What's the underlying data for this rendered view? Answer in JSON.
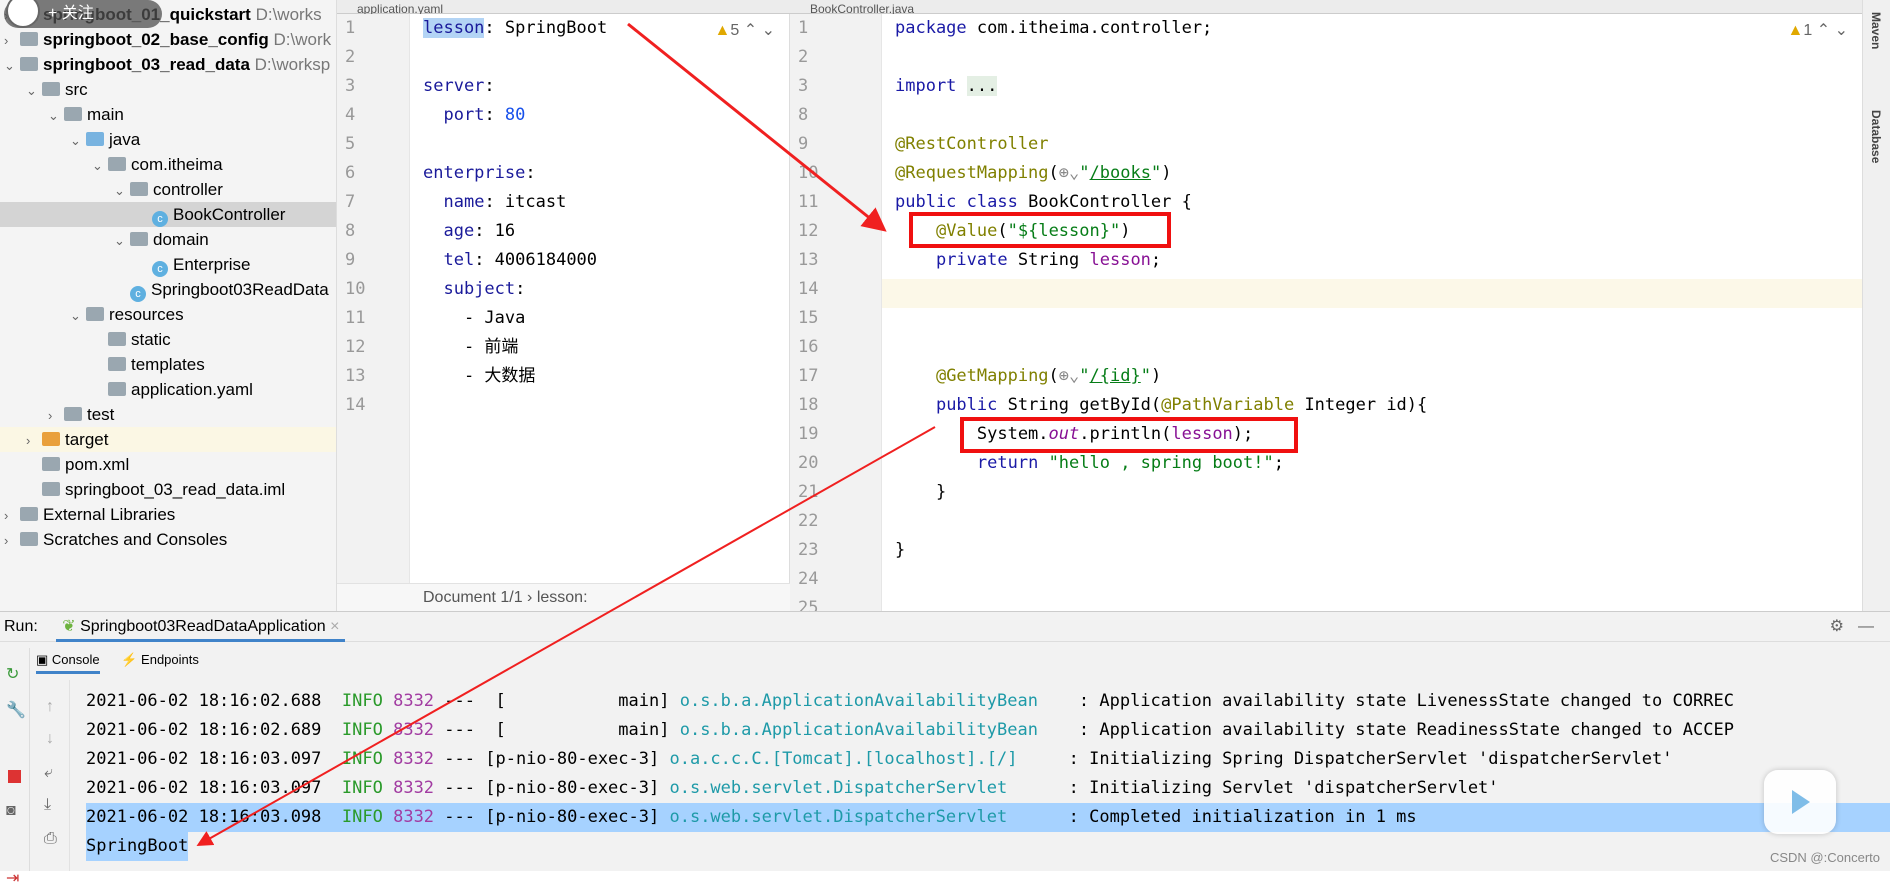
{
  "tree": [
    {
      "label": "springboot_01_quickstart",
      "path": "D:\\works",
      "level": 0,
      "arrow": "›",
      "icon": "module"
    },
    {
      "label": "springboot_02_base_config",
      "path": "D:\\work",
      "level": 0,
      "arrow": "›",
      "icon": "module"
    },
    {
      "label": "springboot_03_read_data",
      "path": "D:\\worksp",
      "level": 0,
      "arrow": "⌄",
      "icon": "module"
    },
    {
      "label": "src",
      "level": 1,
      "arrow": "⌄",
      "icon": "folder"
    },
    {
      "label": "main",
      "level": 2,
      "arrow": "⌄",
      "icon": "folder"
    },
    {
      "label": "java",
      "level": 3,
      "arrow": "⌄",
      "icon": "folder-blue"
    },
    {
      "label": "com.itheima",
      "level": 4,
      "arrow": "⌄",
      "icon": "package"
    },
    {
      "label": "controller",
      "level": 5,
      "arrow": "⌄",
      "icon": "package"
    },
    {
      "label": "BookController",
      "level": 6,
      "arrow": "",
      "icon": "class",
      "selected": true
    },
    {
      "label": "domain",
      "level": 5,
      "arrow": "⌄",
      "icon": "package"
    },
    {
      "label": "Enterprise",
      "level": 6,
      "arrow": "",
      "icon": "class"
    },
    {
      "label": "Springboot03ReadData",
      "level": 5,
      "arrow": "",
      "icon": "class"
    },
    {
      "label": "resources",
      "level": 3,
      "arrow": "⌄",
      "icon": "folder"
    },
    {
      "label": "static",
      "level": 4,
      "arrow": "",
      "icon": "folder"
    },
    {
      "label": "templates",
      "level": 4,
      "arrow": "",
      "icon": "folder"
    },
    {
      "label": "application.yaml",
      "level": 4,
      "arrow": "",
      "icon": "yaml"
    },
    {
      "label": "test",
      "level": 2,
      "arrow": "›",
      "icon": "folder"
    },
    {
      "label": "target",
      "level": 1,
      "arrow": "›",
      "icon": "folder-orange",
      "highlight": true
    },
    {
      "label": "pom.xml",
      "level": 1,
      "arrow": "",
      "icon": "maven"
    },
    {
      "label": "springboot_03_read_data.iml",
      "level": 1,
      "arrow": "",
      "icon": "file"
    },
    {
      "label": "External Libraries",
      "level": 0,
      "arrow": "›",
      "icon": "libs"
    },
    {
      "label": "Scratches and Consoles",
      "level": 0,
      "arrow": "›",
      "icon": "scratch"
    }
  ],
  "follow_badge": "+ 关注",
  "tabs": {
    "yaml": "application.yaml",
    "java": "BookController.java"
  },
  "yaml": {
    "warnings": "5",
    "breadcrumb": "Document 1/1  ›  lesson:",
    "lines": [
      {
        "n": "1",
        "html": "<span class='key' style='background:#b3d4f5'>lesson</span>: SpringBoot"
      },
      {
        "n": "2",
        "html": ""
      },
      {
        "n": "3",
        "html": "<span class='key'>server</span>:"
      },
      {
        "n": "4",
        "html": "  <span class='key'>port</span>: <span class='num'>80</span>"
      },
      {
        "n": "5",
        "html": ""
      },
      {
        "n": "6",
        "html": "<span class='key'>enterprise</span>:"
      },
      {
        "n": "7",
        "html": "  <span class='key'>name</span>: itcast"
      },
      {
        "n": "8",
        "html": "  <span class='key'>age</span>: 16"
      },
      {
        "n": "9",
        "html": "  <span class='key'>tel</span>: 4006184000"
      },
      {
        "n": "10",
        "html": "  <span class='key'>subject</span>:"
      },
      {
        "n": "11",
        "html": "    - Java"
      },
      {
        "n": "12",
        "html": "    - 前端"
      },
      {
        "n": "13",
        "html": "    - 大数据"
      },
      {
        "n": "14",
        "html": ""
      }
    ]
  },
  "java": {
    "warnings": "1",
    "lines": [
      {
        "n": "1",
        "html": "<span class='kw'>package</span> com.itheima.controller;"
      },
      {
        "n": "2",
        "html": ""
      },
      {
        "n": "3",
        "html": "<span class='kw'>import</span> <span style='background:#e4efe4'>...</span>"
      },
      {
        "n": "8",
        "html": ""
      },
      {
        "n": "9",
        "html": "<span class='ann'>@RestController</span>"
      },
      {
        "n": "10",
        "html": "<span class='ann'>@RequestMapping</span>(<span style='color:#888'>⊕⌄</span><span class='str'>\"<u>/books</u>\"</span>)"
      },
      {
        "n": "11",
        "html": "<span class='kw'>public class</span> BookController {"
      },
      {
        "n": "12",
        "html": "    <span class='ann'>@Value</span>(<span class='str'>\"${lesson}\"</span>)"
      },
      {
        "n": "13",
        "html": "    <span class='kw'>private</span> String <span class='fld'>lesson</span>;"
      },
      {
        "n": "14",
        "html": ""
      },
      {
        "n": "15",
        "html": ""
      },
      {
        "n": "16",
        "html": ""
      },
      {
        "n": "17",
        "html": "    <span class='ann'>@GetMapping</span>(<span style='color:#888'>⊕⌄</span><span class='str'>\"<u>/{id}</u>\"</span>)"
      },
      {
        "n": "18",
        "html": "    <span class='kw'>public</span> String getById(<span class='ann'>@PathVariable</span> Integer id){"
      },
      {
        "n": "19",
        "html": "        System.<i class='fld'>out</i>.println(<span class='fld'>lesson</span>);"
      },
      {
        "n": "20",
        "html": "        <span class='kw'>return</span> <span class='str'>\"hello , spring boot!\"</span>;"
      },
      {
        "n": "21",
        "html": "    }"
      },
      {
        "n": "22",
        "html": ""
      },
      {
        "n": "23",
        "html": "}"
      },
      {
        "n": "24",
        "html": ""
      },
      {
        "n": "25",
        "html": ""
      }
    ]
  },
  "run": {
    "label": "Run:",
    "config": "Springboot03ReadDataApplication",
    "console_tab": "Console",
    "endpoints_tab": "Endpoints",
    "logs": [
      {
        "ts": "2021-06-02 18:16:02.688",
        "level": "INFO",
        "pid": "8332",
        "thread": "---  [           main]",
        "logger": "o.s.b.a.ApplicationAvailabilityBean",
        "msg": "    : Application availability state LivenessState changed to CORREC"
      },
      {
        "ts": "2021-06-02 18:16:02.689",
        "level": "INFO",
        "pid": "8332",
        "thread": "---  [           main]",
        "logger": "o.s.b.a.ApplicationAvailabilityBean",
        "msg": "    : Application availability state ReadinessState changed to ACCEP"
      },
      {
        "ts": "2021-06-02 18:16:03.097",
        "level": "INFO",
        "pid": "8332",
        "thread": "--- [p-nio-80-exec-3]",
        "logger": "o.a.c.c.C.[Tomcat].[localhost].[/]",
        "msg": "     : Initializing Spring DispatcherServlet 'dispatcherServlet'"
      },
      {
        "ts": "2021-06-02 18:16:03.097",
        "level": "INFO",
        "pid": "8332",
        "thread": "--- [p-nio-80-exec-3]",
        "logger": "o.s.web.servlet.DispatcherServlet",
        "msg": "      : Initializing Servlet 'dispatcherServlet'"
      },
      {
        "ts": "2021-06-02 18:16:03.098",
        "level": "INFO",
        "pid": "8332",
        "thread": "--- [p-nio-80-exec-3]",
        "logger": "o.s.web.servlet.DispatcherServlet",
        "msg": "      : Completed initialization in 1 ms",
        "selected": true
      }
    ],
    "output": "SpringBoot"
  },
  "right_strip": {
    "maven": "Maven",
    "database": "Database"
  },
  "watermark": "CSDN @:Concerto"
}
